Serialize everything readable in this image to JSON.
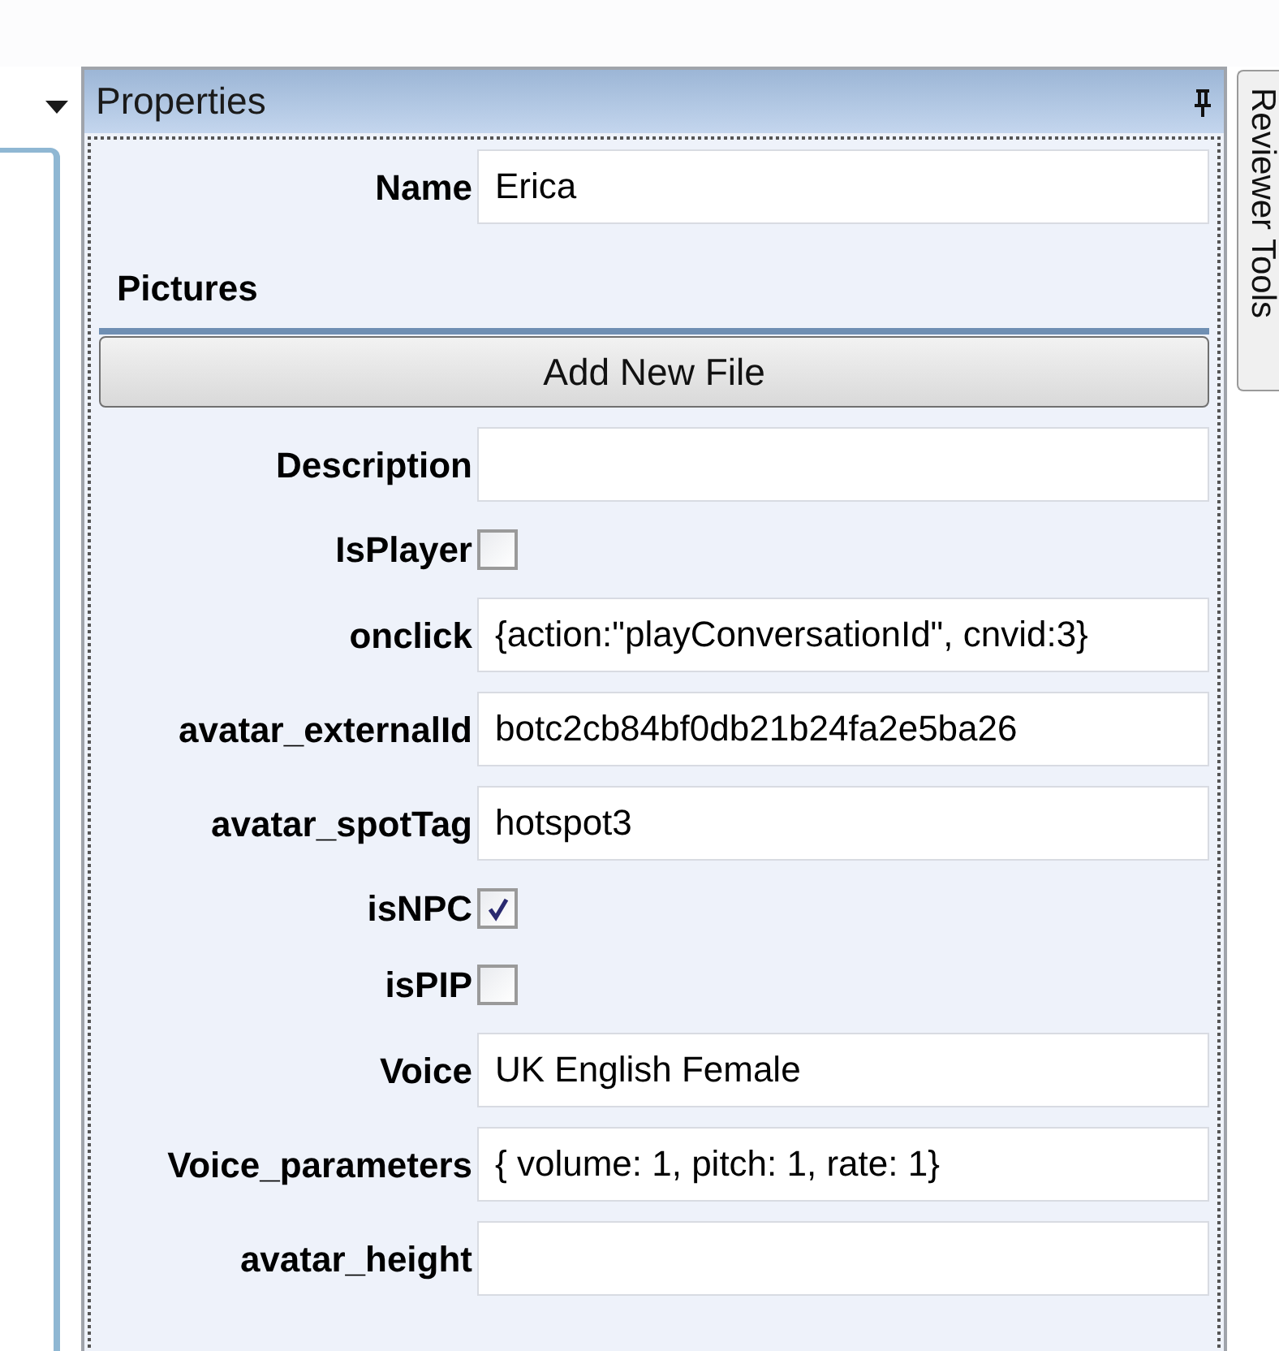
{
  "panel": {
    "title": "Properties"
  },
  "side_tab": {
    "label": "Reviewer Tools"
  },
  "name_field": {
    "label": "Name",
    "value": "Erica"
  },
  "pictures": {
    "title": "Pictures",
    "button": "Add New File"
  },
  "properties": [
    {
      "kind": "text",
      "label": "Description"
    },
    {
      "kind": "checkbox",
      "label": "IsPlayer",
      "checked": false
    },
    {
      "kind": "text",
      "label": "onclick",
      "value": "{action:\"playConversationId\", cnvid:3}"
    },
    {
      "kind": "text",
      "label": "avatar_externalId",
      "value": "botc2cb84bf0db21b24fa2e5ba26"
    },
    {
      "kind": "text",
      "label": "avatar_spotTag",
      "value": "hotspot3"
    },
    {
      "kind": "checkbox",
      "label": "isNPC",
      "checked": true
    },
    {
      "kind": "checkbox",
      "label": "isPIP",
      "checked": false
    },
    {
      "kind": "text",
      "label": "Voice",
      "value": "UK English Female"
    },
    {
      "kind": "text",
      "label": "Voice_parameters",
      "value": "{ volume: 1, pitch: 1, rate: 1}"
    },
    {
      "kind": "text",
      "label": "avatar_height"
    }
  ]
}
